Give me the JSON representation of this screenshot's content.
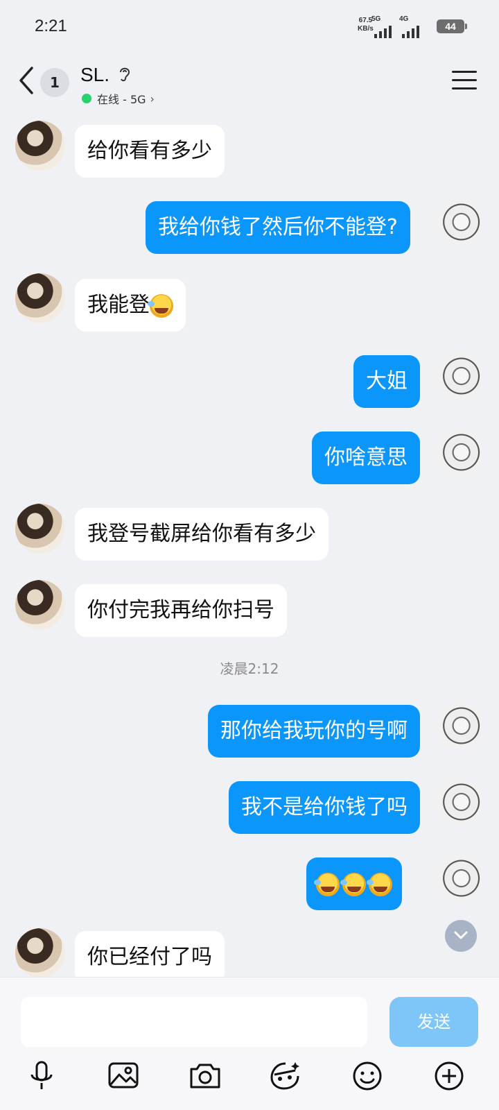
{
  "status_bar": {
    "time": "2:21",
    "speed": "67.5",
    "speed_unit": "KB/s",
    "network_a": "5G",
    "network_b": "4G",
    "battery": "44"
  },
  "header": {
    "unread_count": "1",
    "contact_name": "SL.",
    "presence": "在线 - 5G"
  },
  "messages": [
    {
      "side": "left",
      "text": "给你看有多少"
    },
    {
      "side": "right",
      "text": "我给你钱了然后你不能登?"
    },
    {
      "side": "left",
      "text": "我能登"
    },
    {
      "side": "right",
      "text": "大姐"
    },
    {
      "side": "right",
      "text": "你啥意思"
    },
    {
      "side": "left",
      "text": "我登号截屏给你看有多少"
    },
    {
      "side": "left",
      "text": "你付完我再给你扫号"
    },
    {
      "side": "right",
      "text": "那你给我玩你的号啊"
    },
    {
      "side": "right",
      "text": "我不是给你钱了吗"
    },
    {
      "side": "right",
      "text": ""
    },
    {
      "side": "left",
      "text": "你已经付了吗"
    }
  ],
  "timestamp": "凌晨2:12",
  "composer": {
    "send_label": "发送",
    "placeholder": ""
  },
  "icons": [
    "microphone-icon",
    "image-icon",
    "camera-icon",
    "sticker-icon",
    "emoji-icon",
    "plus-icon"
  ],
  "colors": {
    "sent_bubble": "#0b96fb",
    "received_bubble": "#ffffff",
    "send_button": "#7ec5f8",
    "online_dot": "#2bd16d"
  }
}
